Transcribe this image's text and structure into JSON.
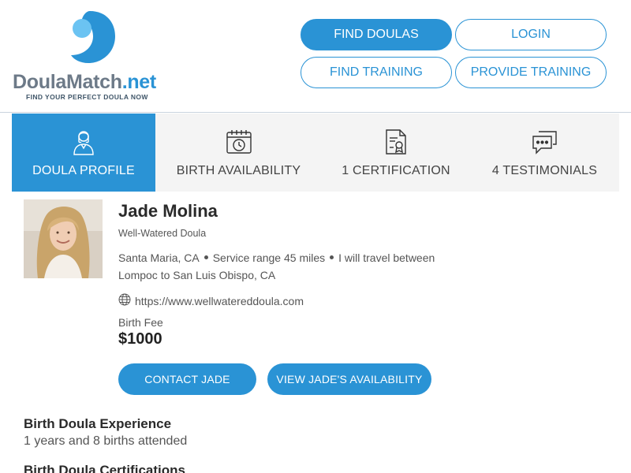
{
  "brand": {
    "name_part1": "Doula",
    "name_part2": "Match",
    "name_part3": ".net",
    "tagline": "FIND YOUR PERFECT DOULA NOW",
    "accent_color": "#2a93d5",
    "gray_color": "#6d7a88"
  },
  "nav": {
    "find_doulas": "FIND DOULAS",
    "login": "LOGIN",
    "find_training": "FIND TRAINING",
    "provide_training": "PROVIDE TRAINING"
  },
  "tabs": [
    {
      "label": "DOULA PROFILE",
      "icon": "person-icon",
      "active": true
    },
    {
      "label": "BIRTH AVAILABILITY",
      "icon": "calendar-clock-icon",
      "active": false
    },
    {
      "label": "1 CERTIFICATION",
      "icon": "certificate-document-icon",
      "active": false
    },
    {
      "label": "4 TESTIMONIALS",
      "icon": "chat-bubbles-icon",
      "active": false
    }
  ],
  "profile": {
    "name": "Jade Molina",
    "business": "Well-Watered Doula",
    "city": "Santa Maria, CA",
    "service_range": "Service range 45 miles",
    "travel_line1": "I will travel between",
    "travel_line2": "Lompoc to San Luis Obispo, CA",
    "website": "https://www.wellwatereddoula.com",
    "fee_label": "Birth Fee",
    "fee_value": "$1000",
    "contact_button": "CONTACT JADE",
    "availability_button": "VIEW JADE'S AVAILABILITY"
  },
  "sections": {
    "experience_title": "Birth Doula Experience",
    "experience_value": "1 years and 8 births attended",
    "certifications_title": "Birth Doula Certifications"
  }
}
